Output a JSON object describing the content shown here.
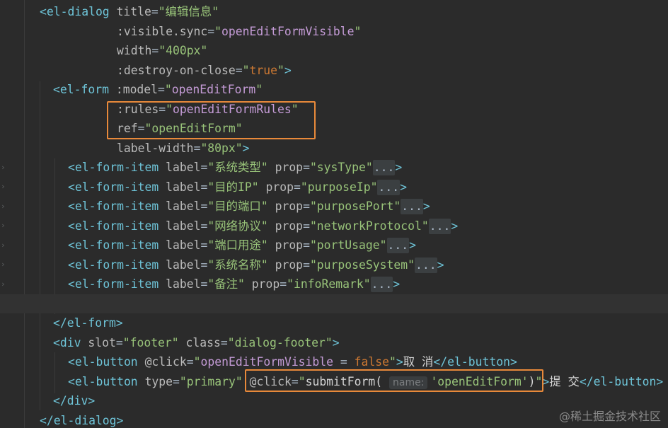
{
  "editor": {
    "lines": [
      "<el-dialog title=\"编辑信息\"",
      ":visible.sync=\"openEditFormVisible\"",
      "width=\"400px\"",
      ":destroy-on-close=\"true\">",
      "<el-form :model=\"openEditForm\"",
      ":rules=\"openEditFormRules\"",
      "ref=\"openEditForm\"",
      "label-width=\"80px\">",
      "<el-form-item label=\"系统类型\" prop=\"sysType\"",
      "<el-form-item label=\"目的IP\" prop=\"purposeIp\"",
      "<el-form-item label=\"目的端口\" prop=\"purposePort\"",
      "<el-form-item label=\"网络协议\" prop=\"networkProtocol\"",
      "<el-form-item label=\"端口用途\" prop=\"portUsage\"",
      "<el-form-item label=\"系统名称\" prop=\"purposeSystem\"",
      "<el-form-item label=\"备注\" prop=\"infoRemark\"",
      "",
      "</el-form>",
      "<div slot=\"footer\" class=\"dialog-footer\">",
      "<el-button @click=\"openEditFormVisible = false\">取 消</el-button>",
      "<el-button type=\"primary\" @click=\"submitForm(",
      "</div>",
      "</el-dialog>"
    ],
    "fold_placeholder": "...",
    "param_hint": "name:",
    "submit_arg": "'openEditForm'",
    "submit_tail": ")\">提 交</el-button>"
  },
  "watermark": "@稀土掘金技术社区"
}
